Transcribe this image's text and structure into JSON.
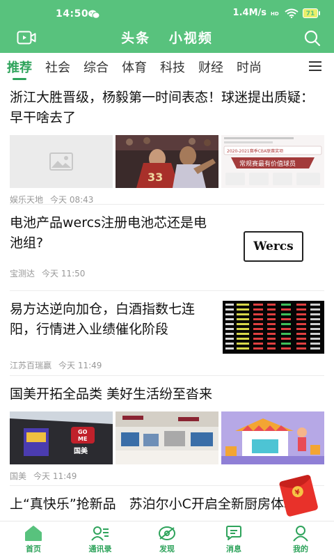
{
  "status": {
    "time": "14:50",
    "speed": "1.4M/s",
    "battery": "71"
  },
  "header": {
    "title_main": "头条",
    "title_video": "小视频"
  },
  "tabs": [
    "推荐",
    "社会",
    "综合",
    "体育",
    "科技",
    "财经",
    "时尚"
  ],
  "articles": [
    {
      "title": "浙江大胜晋级，杨毅第一时间表态！球迷提出质疑：早干啥去了",
      "source": "娱乐天地",
      "time": "今天 08:43",
      "thumb3_caption": "常规赛最有价值球员",
      "thumb3_season": "2020-2021赛季CBA联赛奖项"
    },
    {
      "title": "电池产品wercs注册电池芯还是电池组?",
      "source": "宝测达",
      "time": "今天 11:50",
      "logo_text": "Wercs"
    },
    {
      "title": "易方达逆向加仓，白酒指数七连阳，行情进入业绩催化阶段",
      "source": "江苏百瑞赢",
      "time": "今天 11:49"
    },
    {
      "title": "国美开拓全品类 美好生活纷至沓来",
      "source": "国美",
      "time": "今天 11:49",
      "brand_line1": "GO",
      "brand_line2": "ME",
      "brand_name": "国美"
    },
    {
      "title": "上“真快乐”抢新品　苏泊尔小C开启全新厨房体验"
    }
  ],
  "nav": [
    {
      "label": "首页",
      "icon": "home-icon"
    },
    {
      "label": "通讯录",
      "icon": "contacts-icon"
    },
    {
      "label": "发现",
      "icon": "discover-icon"
    },
    {
      "label": "消息",
      "icon": "message-icon"
    },
    {
      "label": "我的",
      "icon": "profile-icon"
    }
  ],
  "colors": {
    "brand_green": "#58c27d",
    "accent_green": "#2ea35b"
  }
}
